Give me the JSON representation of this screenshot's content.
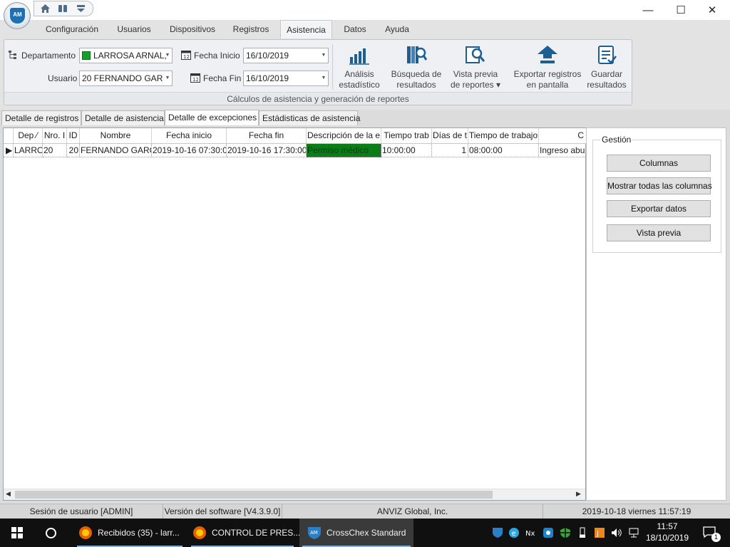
{
  "window": {
    "controls": {
      "minimize": "—",
      "maximize": "☐",
      "close": "✕"
    }
  },
  "logo": {
    "text": "AM"
  },
  "ribbon_tabs": [
    "Configuración",
    "Usuarios",
    "Dispositivos",
    "Registros",
    "Asistencia",
    "Datos",
    "Ayuda"
  ],
  "active_ribbon_tab": "Asistencia",
  "filters": {
    "departamento_label": "Departamento",
    "departamento_value": "LARROSA ARNAL,",
    "usuario_label": "Usuario",
    "usuario_value": "20    FERNANDO GAR",
    "fecha_inicio_label": "Fecha Inicio",
    "fecha_inicio_value": "16/10/2019",
    "fecha_fin_label": "Fecha Fin",
    "fecha_fin_value": "16/10/2019"
  },
  "ribbon_buttons": [
    {
      "line1": "Análisis",
      "line2": "estadístico",
      "icon": "bar-chart-icon"
    },
    {
      "line1": "Búsqueda de",
      "line2": "resultados",
      "icon": "book-search-icon"
    },
    {
      "line1": "Vista previa",
      "line2": "de reportes ▾",
      "icon": "preview-magnifier-icon"
    },
    {
      "line1": "Exportar registros",
      "line2": "en pantalla",
      "icon": "export-arrow-icon"
    },
    {
      "line1": "Guardar",
      "line2": "resultados",
      "icon": "save-document-icon"
    }
  ],
  "ribbon_group_caption": "Cálculos de asistencia y generación de reportes",
  "doc_tabs": [
    "Detalle de registros",
    "Detalle de asistencia",
    "Detalle de excepciones",
    "Estádisticas de asistencia"
  ],
  "active_doc_tab": "Detalle de excepciones",
  "grid": {
    "columns": [
      "Dep ⁄",
      "Nro. I",
      "ID",
      "Nombre",
      "Fecha inicio",
      "Fecha fin",
      "Descripción de la e",
      "Tiempo trab",
      "Días de t",
      "Tiempo de trabajo",
      "C"
    ],
    "rows": [
      [
        "LARRO",
        "20",
        "20",
        "FERNANDO GARC",
        "2019-10-16 07:30:0(",
        "2019-10-16 17:30:00",
        "Permiso médico",
        "10:00:00",
        "1",
        "08:00:00",
        "Ingreso abu"
      ]
    ],
    "highlight_color": "#0a7d18"
  },
  "gestion": {
    "title": "Gestión",
    "buttons": [
      "Columnas",
      "Mostrar todas las columnas",
      "Exportar datos",
      "Vista previa"
    ]
  },
  "status": {
    "session": "Sesión de usuario  [ADMIN]",
    "version": "Versión del software  [V4.3.9.0]",
    "company": "ANVIZ Global, Inc.",
    "datetime": "2019-10-18 viernes 11:57:19"
  },
  "taskbar": {
    "items": [
      "Recibidos (35) - larr...",
      "CONTROL DE PRES...",
      "CrossChex Standard"
    ],
    "time": "11:57",
    "date": "18/10/2019",
    "notification_count": "1"
  }
}
